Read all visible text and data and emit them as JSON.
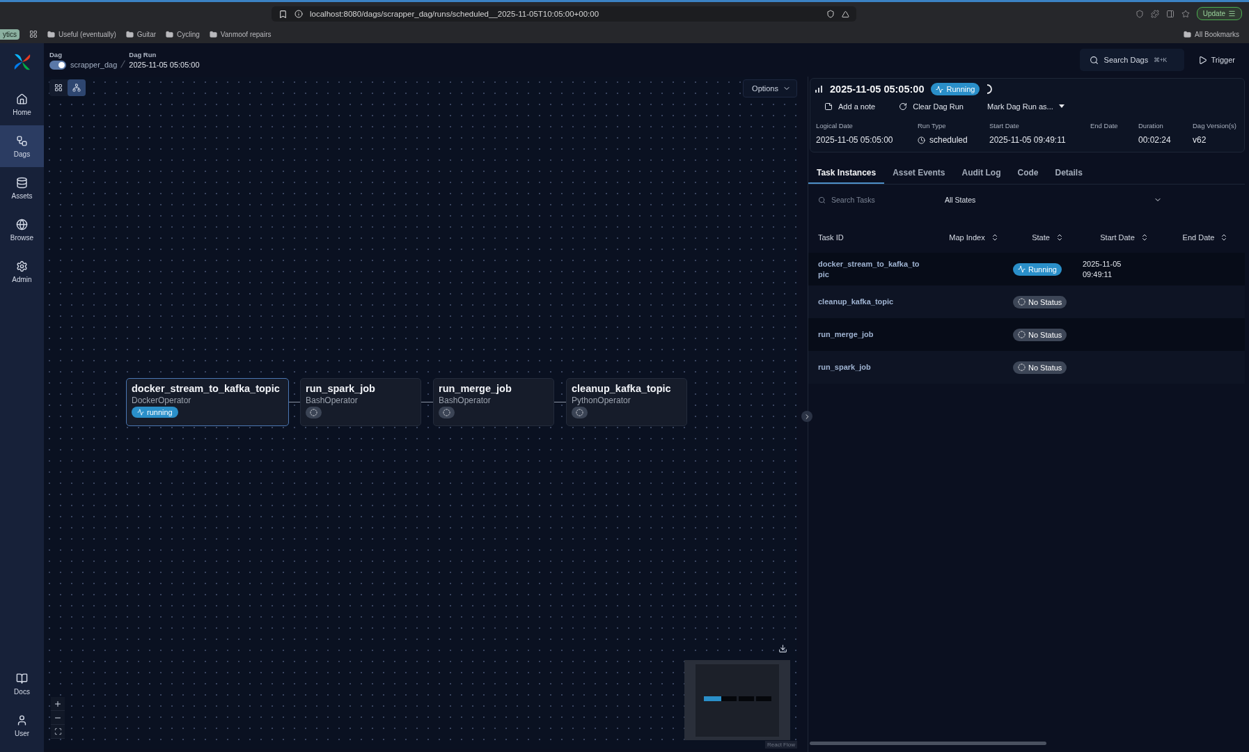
{
  "browser": {
    "url": "localhost:8080/dags/scrapper_dag/runs/scheduled__2025-11-05T10:05:00+00:00",
    "group_tab": "ytics",
    "bookmarks": [
      "Useful (eventually)",
      "Guitar",
      "Cycling",
      "Vanmoof repairs"
    ],
    "all_bookmarks": "All Bookmarks",
    "update_button": "Update"
  },
  "sidebar": {
    "items": [
      {
        "label": "Home",
        "selected": false
      },
      {
        "label": "Dags",
        "selected": true
      },
      {
        "label": "Assets",
        "selected": false
      },
      {
        "label": "Browse",
        "selected": false
      },
      {
        "label": "Admin",
        "selected": false
      }
    ],
    "bottom_items": [
      {
        "label": "Docs",
        "selected": false
      },
      {
        "label": "User",
        "selected": false
      }
    ]
  },
  "header": {
    "dag_label": "Dag",
    "dag_name": "scrapper_dag",
    "dag_enabled": true,
    "run_label": "Dag Run",
    "run_value": "2025-11-05 05:05:00",
    "search": "Search Dags",
    "shortcut": "⌘+K",
    "trigger": "Trigger"
  },
  "canvas": {
    "views": [
      {
        "kind": "grid",
        "selected": false
      },
      {
        "kind": "graph",
        "selected": true
      }
    ],
    "options": "Options",
    "attribution": "React Flow",
    "nodes": [
      {
        "name": "docker_stream_to_kafka_topic",
        "operator": "DockerOperator",
        "running": true,
        "status": "running",
        "selected": true
      },
      {
        "name": "run_spark_job",
        "operator": "BashOperator",
        "running": false,
        "selected": false
      },
      {
        "name": "run_merge_job",
        "operator": "BashOperator",
        "running": false,
        "selected": false
      },
      {
        "name": "cleanup_kafka_topic",
        "operator": "PythonOperator",
        "running": false,
        "selected": false
      }
    ]
  },
  "run": {
    "title": "2025-11-05 05:05:00",
    "status": "Running",
    "actions": [
      {
        "kind": "note",
        "label": "Add a note"
      },
      {
        "kind": "clear",
        "label": "Clear Dag Run"
      },
      {
        "kind": "menu",
        "label": "Mark Dag Run as..."
      }
    ],
    "details": [
      {
        "label": "Logical Date",
        "value": "2025-11-05 05:05:00",
        "kind": "plain"
      },
      {
        "label": "Run Type",
        "value": "scheduled",
        "kind": "schedule"
      },
      {
        "label": "Start Date",
        "value": "2025-11-05 09:49:11",
        "kind": "plain"
      },
      {
        "label": "End Date",
        "kind": "plain"
      },
      {
        "label": "Duration",
        "value": "00:02:24",
        "kind": "plain"
      },
      {
        "label": "Dag Version(s)",
        "value": "v62",
        "kind": "plain"
      }
    ],
    "tabs": [
      {
        "label": "Task Instances",
        "selected": true
      },
      {
        "label": "Asset Events",
        "selected": false
      },
      {
        "label": "Audit Log",
        "selected": false
      },
      {
        "label": "Code",
        "selected": false
      },
      {
        "label": "Details",
        "selected": false
      }
    ],
    "search_placeholder": "Search Tasks",
    "state_filter": "All States",
    "columns": [
      {
        "label": "Task ID",
        "sortable": false
      },
      {
        "label": "Map Index",
        "sortable": true
      },
      {
        "label": "State",
        "sortable": true
      },
      {
        "label": "Start Date",
        "sortable": true
      },
      {
        "label": "End Date",
        "sortable": true
      }
    ],
    "rows": [
      {
        "task_id": "docker_stream_to_kafka_to\npic",
        "running": true,
        "state_label": "Running",
        "start_date": "2025-11-05\n09:49:11"
      },
      {
        "task_id": "cleanup_kafka_topic",
        "running": false,
        "state_label": "No Status"
      },
      {
        "task_id": "run_merge_job",
        "running": false,
        "state_label": "No Status"
      },
      {
        "task_id": "run_spark_job",
        "running": false,
        "state_label": "No Status"
      }
    ]
  }
}
